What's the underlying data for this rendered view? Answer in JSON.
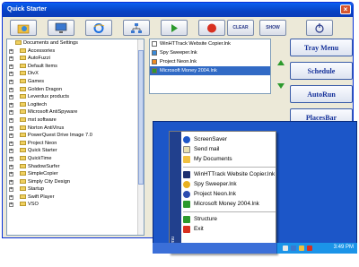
{
  "window": {
    "title": "Quick Starter",
    "close_glyph": "×"
  },
  "toolbar": [
    {
      "name": "folder-globe-icon",
      "label": ""
    },
    {
      "name": "monitor-icon",
      "label": ""
    },
    {
      "name": "ie-icon",
      "label": ""
    },
    {
      "name": "network-icon",
      "label": ""
    },
    {
      "name": "play-icon",
      "label": ""
    },
    {
      "name": "stop-icon",
      "label": ""
    },
    {
      "label": "CLEAR"
    },
    {
      "label": "SHOW"
    },
    {
      "name": "power-icon",
      "label": ""
    }
  ],
  "tree": {
    "root": "Documents and Settings",
    "items": [
      "Accessories",
      "AutoFuzzi",
      "Default Items",
      "DivX",
      "Games",
      "Golden Dragon",
      "Leverdux products",
      "Logitech",
      "Microsoft AntiSpyware",
      "mxt software",
      "Norton AntiVirus",
      "PowerQuest Drive Image 7.0",
      "Project Neon",
      "Quick Starter",
      "QuickTime",
      "ShadowSurfer",
      "SimpleCopier",
      "Simply City Design",
      "Startup",
      "Swift Player",
      "VSO"
    ]
  },
  "links": [
    "WinHTTrack Website Copier.lnk",
    "Spy Sweeper.lnk",
    "Project Neon.lnk",
    "Microsoft Money 2004.lnk"
  ],
  "buttons": {
    "tray_menu": "Tray Menu",
    "schedule": "Schedule",
    "autorun": "AutoRun",
    "placesbar": "PlacesBar"
  },
  "menu": {
    "side_label": "Menu",
    "items": [
      "ScreenSaver",
      "Send mail",
      "My Documents",
      "WinHTTrack Website Copier.lnk",
      "Spy Sweeper.lnk",
      "Project Neon.lnk",
      "Microsoft Money 2004.lnk",
      "Structure",
      "Exit"
    ]
  },
  "clock": "3:49 PM",
  "colors": {
    "title": "#0a4fd6",
    "button_text": "#15319a",
    "selection": "#316ac5",
    "menu_side": "#21408d"
  }
}
